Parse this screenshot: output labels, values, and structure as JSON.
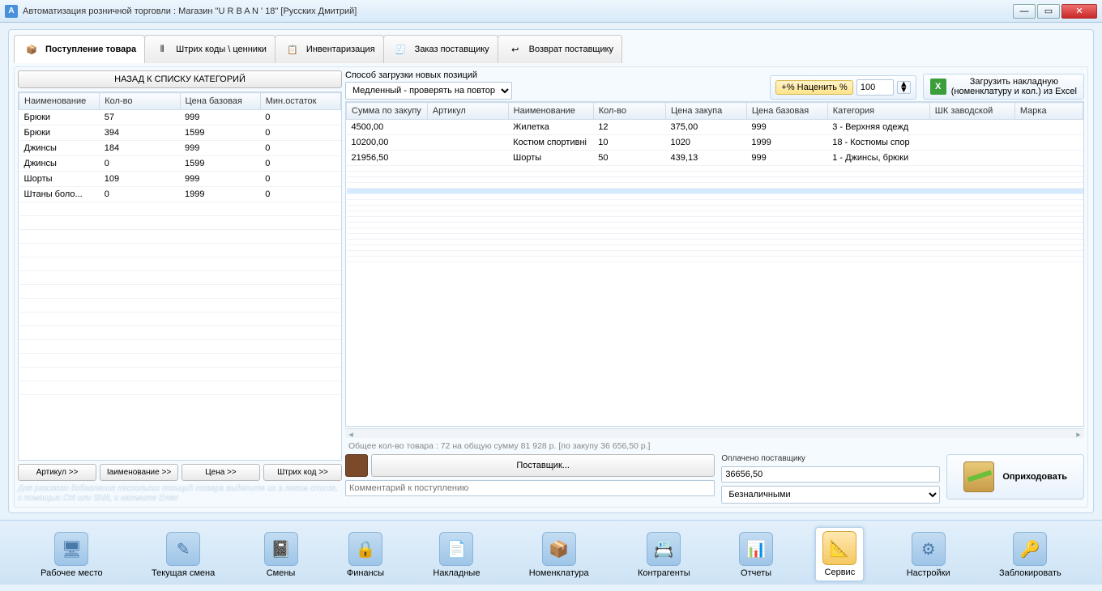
{
  "window": {
    "title": "Автоматизация розничной торговли : Магазин \"U R B A N ' 18\" [Русских Дмитрий]",
    "icon_letter": "A"
  },
  "tabs": [
    {
      "label": "Поступление товара",
      "active": true
    },
    {
      "label": "Штрих коды \\ ценники"
    },
    {
      "label": "Инвентаризация"
    },
    {
      "label": "Заказ поставщику"
    },
    {
      "label": "Возврат поставщику"
    }
  ],
  "left": {
    "back_btn": "НАЗАД К СПИСКУ КАТЕГОРИЙ",
    "headers": [
      "Наименование",
      "Кол-во",
      "Цена базовая",
      "Мин.остаток"
    ],
    "rows": [
      [
        "Брюки",
        "57",
        "999",
        "0"
      ],
      [
        "Брюки",
        "394",
        "1599",
        "0"
      ],
      [
        "Джинсы",
        "184",
        "999",
        "0"
      ],
      [
        "Джинсы",
        "0",
        "1599",
        "0"
      ],
      [
        "Шорты",
        "109",
        "999",
        "0"
      ],
      [
        "Штаны боло...",
        "0",
        "1999",
        "0"
      ]
    ],
    "quick": [
      "Артикул >>",
      "Iаименование >>",
      "Цена >>",
      "Штрих код >>"
    ],
    "hint": "Для разового добавления нескольких позиций товара выделите их в левом списке, с помощью Ctrl или Shift, и нажмите Enter"
  },
  "right": {
    "loadmode_label": "Способ загрузки новых позиций",
    "loadmode_value": "Медленный - проверять на повтор",
    "markup_chip": "Наценить %",
    "markup_value": "100",
    "loadexcel_line1": "Загрузить накладную",
    "loadexcel_line2": "(номенклатуру и кол.) из Excel",
    "headers": [
      "Сумма по закупу",
      "Артикул",
      "Наименование",
      "Кол-во",
      "Цена закупа",
      "Цена базовая",
      "Категория",
      "ШК заводской",
      "Марка"
    ],
    "rows": [
      [
        "4500,00",
        "",
        "Жилетка",
        "12",
        "375,00",
        "999",
        "3 - Верхняя одежд",
        "",
        ""
      ],
      [
        "10200,00",
        "",
        "Костюм спортивнi",
        "10",
        "1020",
        "1999",
        "18 - Костюмы спор",
        "",
        ""
      ],
      [
        "21956,50",
        "",
        "Шорты",
        "50",
        "439,13",
        "999",
        "1 - Джинсы, брюки",
        "",
        ""
      ]
    ],
    "summary": "Общее кол-во товара : 72 на общую сумму 81 928 р. [по закупу 36 656,50 р.]",
    "supplier_btn": "Поставщик...",
    "comment_placeholder": "Комментарий к поступлению",
    "paid_label": "Оплачено поставщику",
    "paid_value": "36656,50",
    "paymethod": "Безналичными",
    "receive_btn": "Оприходовать"
  },
  "bottombar": [
    {
      "label": "Рабочее место",
      "glyph": "🖥"
    },
    {
      "label": "Текущая смена",
      "glyph": "✎"
    },
    {
      "label": "Смены",
      "glyph": "📓"
    },
    {
      "label": "Финансы",
      "glyph": "🔒"
    },
    {
      "label": "Накладные",
      "glyph": "📄"
    },
    {
      "label": "Номенклатура",
      "glyph": "📦"
    },
    {
      "label": "Контрагенты",
      "glyph": "📇"
    },
    {
      "label": "Отчеты",
      "glyph": "📊"
    },
    {
      "label": "Сервис",
      "glyph": "📐",
      "active": true
    },
    {
      "label": "Настройки",
      "glyph": "⚙"
    },
    {
      "label": "Заблокировать",
      "glyph": "🔑"
    }
  ]
}
